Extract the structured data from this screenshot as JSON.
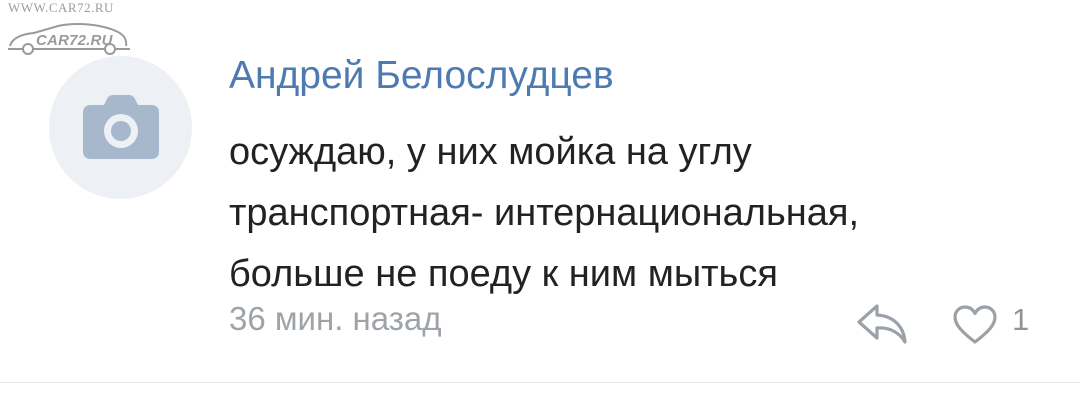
{
  "watermark": {
    "url": "WWW.CAR72.RU",
    "logo": "CAR72.RU"
  },
  "comment": {
    "author": "Андрей Белослудцев",
    "text_lines": [
      "осуждаю, у них мойка на углу",
      "транспортная- интернациональная,",
      "больше не поеду к ним мыться"
    ],
    "time": "36 мин. назад",
    "likes": "1"
  },
  "icons": {
    "avatar": "camera-icon",
    "reply": "reply-arrow-icon",
    "like": "heart-outline-icon"
  },
  "colors": {
    "author": "#4d7ab1",
    "text": "#222222",
    "meta": "#9ea3a8",
    "icon": "#9ba1a8",
    "avatar_bg": "#edf0f4",
    "avatar_icon": "#a8b8cc"
  }
}
